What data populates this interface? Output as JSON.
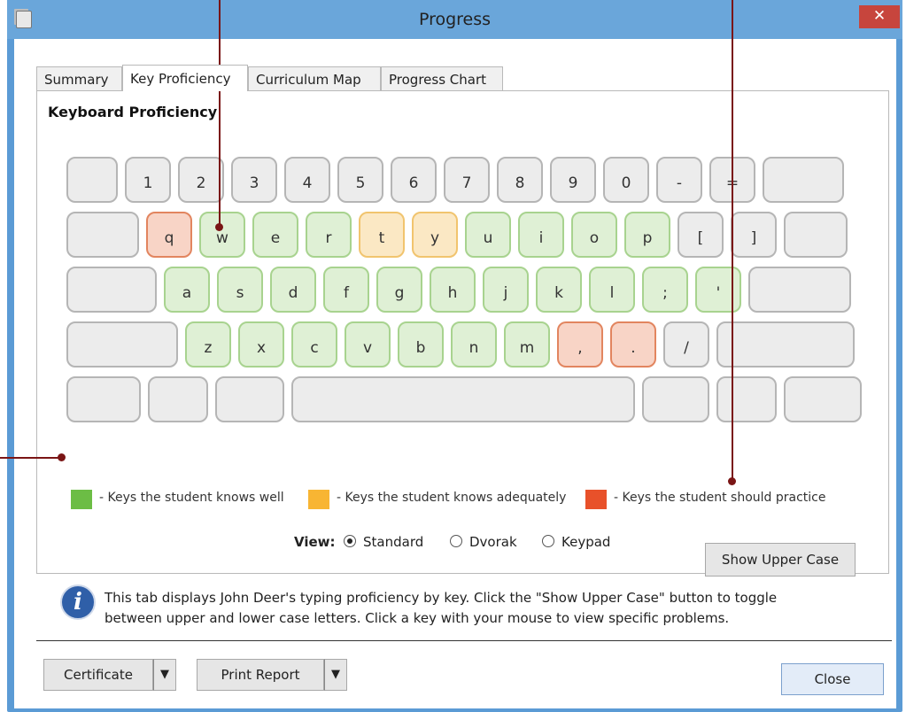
{
  "window": {
    "title": "Progress",
    "close_glyph": "✕",
    "icon": "app-icon"
  },
  "tabs": [
    {
      "label": "Summary"
    },
    {
      "label": "Key Proficiency"
    },
    {
      "label": "Curriculum Map"
    },
    {
      "label": "Progress Chart"
    }
  ],
  "panel": {
    "title": "Keyboard Proficiency"
  },
  "keyboard": {
    "rows": [
      [
        "",
        "1",
        "2",
        "3",
        "4",
        "5",
        "6",
        "7",
        "8",
        "9",
        "0",
        "-",
        "=",
        ""
      ],
      [
        "",
        "q",
        "w",
        "e",
        "r",
        "t",
        "y",
        "u",
        "i",
        "o",
        "p",
        "[",
        "]",
        ""
      ],
      [
        "",
        "a",
        "s",
        "d",
        "f",
        "g",
        "h",
        "j",
        "k",
        "l",
        ";",
        "'",
        ""
      ],
      [
        "",
        "z",
        "x",
        "c",
        "v",
        "b",
        "n",
        "m",
        ",",
        ".",
        "/",
        ""
      ],
      [
        "",
        "",
        "",
        "",
        "",
        "",
        ""
      ]
    ],
    "proficiency": {
      "q": "practice",
      "w": "well",
      "e": "well",
      "r": "well",
      "t": "adequate",
      "y": "adequate",
      "u": "well",
      "i": "well",
      "o": "well",
      "p": "well",
      "a": "well",
      "s": "well",
      "d": "well",
      "f": "well",
      "g": "well",
      "h": "well",
      "j": "well",
      "k": "well",
      "l": "well",
      ";": "well",
      "'": "well",
      "z": "well",
      "x": "well",
      "c": "well",
      "v": "well",
      "b": "well",
      "n": "well",
      "m": "well",
      ",": "practice",
      ".": "practice"
    }
  },
  "legend": {
    "well": {
      "text": "- Keys the student knows well",
      "color": "#6cbd45"
    },
    "adequate": {
      "text": "- Keys the student knows adequately",
      "color": "#f8b533"
    },
    "practice": {
      "text": "- Keys the student should practice",
      "color": "#e8512a"
    }
  },
  "view": {
    "label": "View:",
    "options": [
      "Standard",
      "Dvorak",
      "Keypad"
    ],
    "selected": "Standard"
  },
  "buttons": {
    "show_upper_case": "Show Upper Case",
    "certificate": "Certificate",
    "print_report": "Print Report",
    "dropdown_glyph": "▼",
    "close": "Close"
  },
  "info": {
    "icon_glyph": "i",
    "line1": "This tab displays John Deer's typing proficiency by key. Click the \"Show Upper Case\" button to toggle",
    "line2": "between upper and lower case letters. Click a key with your mouse to view specific problems."
  }
}
